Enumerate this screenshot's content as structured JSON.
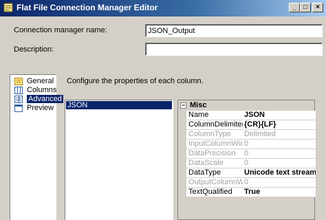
{
  "window": {
    "title": "Flat File Connection Manager Editor",
    "controls": {
      "minimize": "_",
      "maximize": "□",
      "close": "×"
    }
  },
  "form": {
    "connection_name_label": "Connection manager name:",
    "connection_name_value": "JSON_Output",
    "description_label": "Description:",
    "description_value": ""
  },
  "nav": {
    "items": [
      {
        "label": "General",
        "icon": "general-icon"
      },
      {
        "label": "Columns",
        "icon": "columns-icon"
      },
      {
        "label": "Advanced",
        "icon": "advanced-icon",
        "selected": true
      },
      {
        "label": "Preview",
        "icon": "preview-icon"
      }
    ]
  },
  "main": {
    "instruction": "Configure the properties of each column.",
    "columns": [
      "JSON"
    ]
  },
  "properties": {
    "category": "Misc",
    "collapse_glyph": "−",
    "rows": [
      {
        "name": "Name",
        "value": "JSON",
        "enabled": true,
        "bold": true
      },
      {
        "name": "ColumnDelimiter",
        "value": "{CR}{LF}",
        "enabled": true,
        "bold": true
      },
      {
        "name": "ColumnType",
        "value": "Delimited",
        "enabled": false,
        "bold": false
      },
      {
        "name": "InputColumnWidth",
        "value": "0",
        "enabled": false,
        "bold": false
      },
      {
        "name": "DataPrecision",
        "value": "0",
        "enabled": false,
        "bold": false
      },
      {
        "name": "DataScale",
        "value": "0",
        "enabled": false,
        "bold": false
      },
      {
        "name": "DataType",
        "value": "Unicode text stream",
        "enabled": true,
        "bold": true
      },
      {
        "name": "OutputColumnWid",
        "value": "0",
        "enabled": false,
        "bold": false
      },
      {
        "name": "TextQualified",
        "value": "True",
        "enabled": true,
        "bold": true
      }
    ]
  },
  "colors": {
    "titlebar_start": "#0a246a",
    "titlebar_end": "#a6caf0",
    "selection": "#0a246a",
    "dialog_face": "#d4d0c8"
  }
}
